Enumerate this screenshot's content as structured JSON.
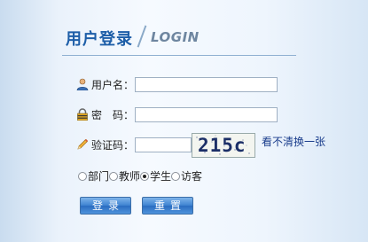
{
  "header": {
    "title_cn": "用户登录",
    "title_en": "LOGIN"
  },
  "form": {
    "username": {
      "label": "用户名：",
      "value": "",
      "icon": "user-icon"
    },
    "password": {
      "label": "密　码：",
      "value": "",
      "icon": "lock-icon"
    },
    "captcha": {
      "label": "验证码：",
      "value": "",
      "icon": "pencil-icon",
      "image_text": "215c",
      "refresh_label": "看不清换一张"
    },
    "roles": [
      {
        "label": "部门",
        "checked": false
      },
      {
        "label": "教师",
        "checked": false
      },
      {
        "label": "学生",
        "checked": true
      },
      {
        "label": "访客",
        "checked": false
      }
    ]
  },
  "buttons": {
    "login_label": "登录",
    "reset_label": "重置"
  },
  "colors": {
    "title": "#1d5ea8",
    "subtitle": "#6e86a0",
    "button": "#3f84d2",
    "link": "#1a3d8c"
  }
}
